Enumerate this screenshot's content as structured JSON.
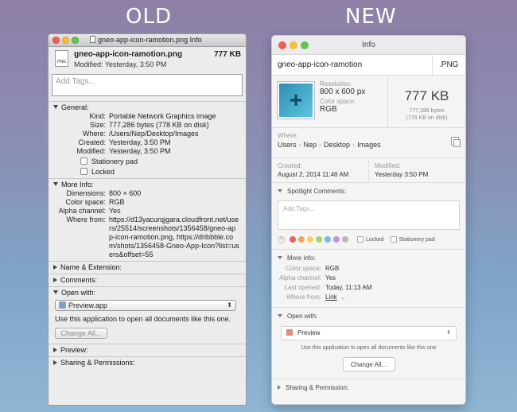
{
  "labels": {
    "old": "OLD",
    "new": "NEW"
  },
  "old": {
    "title": "gneo-app-icon-ramotion.png Info",
    "file_icon_label": "PNG",
    "filename": "gneo-app-icon-ramotion.png",
    "size": "777 KB",
    "modified": "Modified: Yesterday, 3:50 PM",
    "tags_placeholder": "Add Tags...",
    "general": {
      "header": "General:",
      "rows": [
        {
          "k": "Kind:",
          "v": "Portable Network Graphics image"
        },
        {
          "k": "Size:",
          "v": "777,286 bytes (778 KB on disk)"
        },
        {
          "k": "Where:",
          "v": "/Users/Nep/Desktop/Images"
        },
        {
          "k": "Created:",
          "v": "Yesterday, 3:50 PM"
        },
        {
          "k": "Modified:",
          "v": "Yesterday, 3:50 PM"
        }
      ],
      "stationery": "Stationery pad",
      "locked": "Locked"
    },
    "more_info": {
      "header": "More Info:",
      "rows": [
        {
          "k": "Dimensions:",
          "v": "800 × 600"
        },
        {
          "k": "Color space:",
          "v": "RGB"
        },
        {
          "k": "Alpha channel:",
          "v": "Yes"
        },
        {
          "k": "Where from:",
          "v": "https://d13yacurqjgara.cloudfront.net/users/25514/screenshots/1356458/gneo-app-icon-ramotion.png, https://dribbble.com/shots/1356458-Gneo-App-Icon?list=users&offset=55"
        }
      ]
    },
    "name_ext": "Name & Extension:",
    "comments": "Comments:",
    "open_with": {
      "header": "Open with:",
      "app": "Preview.app",
      "note": "Use this application to open all documents like this one.",
      "button": "Change All..."
    },
    "preview": "Preview:",
    "sharing": "Sharing & Permissions:"
  },
  "new": {
    "title": "Info",
    "name": "gneo-app-icon-ramotion",
    "ext": ".PNG",
    "resolution_label": "Resolution:",
    "resolution": "800 x 600 px",
    "colorspace_label": "Color space:",
    "colorspace": "RGB",
    "size": "777 KB",
    "bytes": "777,286 bytes",
    "on_disk": "(778 KB on disk)",
    "where_label": "Where:",
    "path": [
      "Users",
      "Nep",
      "Desktop",
      "Images"
    ],
    "created_label": "Created:",
    "created": "August 2, 2014 11:48 AM",
    "modified_label": "Modified:",
    "modified": "Yesterday 3:50 PM",
    "spotlight": {
      "header": "Spotlight Comments:",
      "placeholder": "Add Tags...",
      "colors": [
        "#e8606a",
        "#f2a45a",
        "#f4d35e",
        "#a6d36a",
        "#7ab6e8",
        "#c38fe0",
        "#b8b8b8"
      ],
      "locked": "Locked",
      "stationery": "Stationery pad"
    },
    "more_info": {
      "header": "More info:",
      "colorspace_k": "Color space:",
      "colorspace_v": "RGB",
      "alpha_k": "Alpha channel:",
      "alpha_v": "Yes",
      "opened_k": "Last opened:",
      "opened_v": "Today, 11:13 AM",
      "wherefrom_k": "Where from:",
      "wherefrom_v": "Link"
    },
    "open_with": {
      "header": "Open with:",
      "app": "Preview",
      "note": "Use this application to open all documents like this one",
      "button": "Change All..."
    },
    "sharing": "Sharing & Permission:"
  }
}
